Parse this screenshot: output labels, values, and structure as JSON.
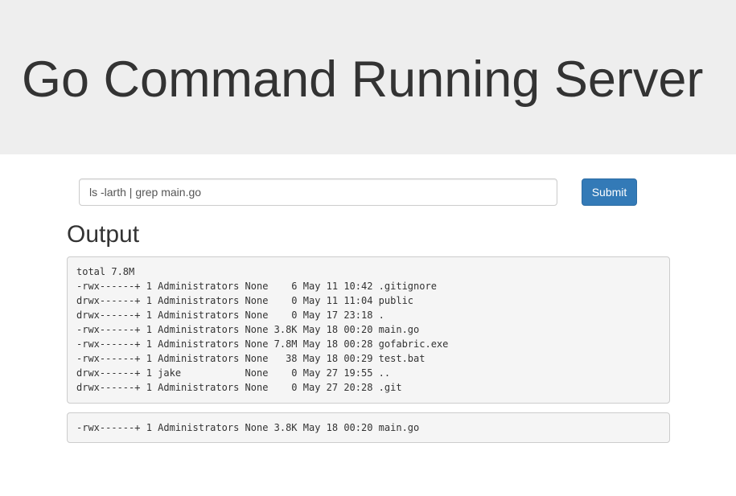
{
  "header": {
    "title": "Go Command Running Server"
  },
  "form": {
    "command_value": "ls -larth | grep main.go",
    "submit_label": "Submit"
  },
  "output": {
    "heading": "Output",
    "previous_lines": [
      "total 7.8M",
      "-rwx------+ 1 Administrators None    6 May 11 10:42 .gitignore",
      "drwx------+ 1 Administrators None    0 May 11 11:04 public",
      "drwx------+ 1 Administrators None    0 May 17 23:18 .",
      "-rwx------+ 1 Administrators None 3.8K May 18 00:20 main.go",
      "-rwx------+ 1 Administrators None 7.8M May 18 00:28 gofabric.exe",
      "-rwx------+ 1 Administrators None   38 May 18 00:29 test.bat",
      "drwx------+ 1 jake           None    0 May 27 19:55 ..",
      "drwx------+ 1 Administrators None    0 May 27 20:28 .git"
    ],
    "latest_lines": [
      "-rwx------+ 1 Administrators None 3.8K May 18 00:20 main.go"
    ]
  }
}
